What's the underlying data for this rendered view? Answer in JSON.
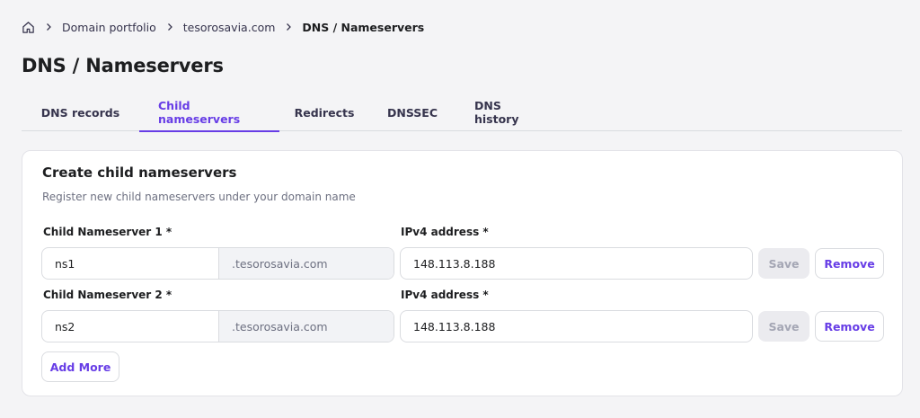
{
  "breadcrumb": {
    "items": [
      "Domain portfolio",
      "tesorosavia.com"
    ],
    "current": "DNS / Nameservers"
  },
  "page_title": "DNS / Nameservers",
  "tabs": [
    {
      "label": "DNS records",
      "active": false
    },
    {
      "label": "Child nameservers",
      "active": true
    },
    {
      "label": "Redirects",
      "active": false
    },
    {
      "label": "DNSSEC",
      "active": false
    },
    {
      "label": "DNS history",
      "active": false
    }
  ],
  "card": {
    "title": "Create child nameservers",
    "subtitle": "Register new child nameservers under your domain name",
    "rows": [
      {
        "ns_label": "Child Nameserver 1 *",
        "ns_value": "ns1",
        "ns_suffix": ".tesorosavia.com",
        "ip_label": "IPv4 address *",
        "ip_value": "148.113.8.188",
        "save_label": "Save",
        "remove_label": "Remove"
      },
      {
        "ns_label": "Child Nameserver 2 *",
        "ns_value": "ns2",
        "ns_suffix": ".tesorosavia.com",
        "ip_label": "IPv4 address *",
        "ip_value": "148.113.8.188",
        "save_label": "Save",
        "remove_label": "Remove"
      }
    ],
    "add_more_label": "Add More"
  },
  "colors": {
    "accent": "#673de6",
    "background": "#f4f4f6",
    "disabled_button": "#ebebef"
  },
  "icons": {
    "home": "home-icon",
    "separator": "chevron-right-icon"
  }
}
